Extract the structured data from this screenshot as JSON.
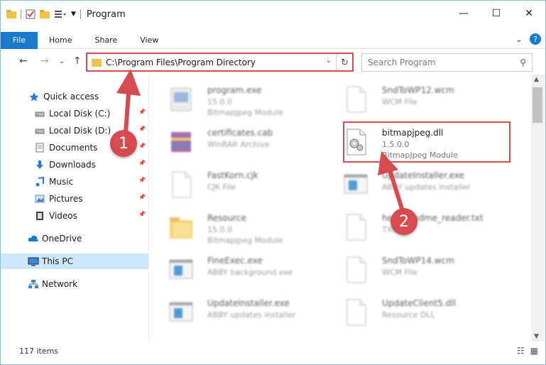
{
  "window": {
    "title": "Program",
    "min": "—",
    "max": "☐",
    "close": "✕"
  },
  "ribbon": {
    "file": "File",
    "tabs": [
      "Home",
      "Share",
      "View"
    ],
    "expand": "⌄",
    "help": "?"
  },
  "nav": {
    "back": "←",
    "forward": "→",
    "recent": "⌄",
    "up": "↑",
    "address": "C:\\Program Files\\Program Directory",
    "dropdown": "⌄",
    "refresh": "↻",
    "search_placeholder": "Search Program",
    "search_icon": "⚲"
  },
  "sidebar": {
    "items": [
      {
        "label": "Quick access",
        "icon": "star-icon",
        "pinned": false
      },
      {
        "label": "Local Disk (C:)",
        "icon": "drive-icon",
        "pinned": true
      },
      {
        "label": "Local Disk (D:)",
        "icon": "drive-icon",
        "pinned": true
      },
      {
        "label": "Documents",
        "icon": "documents-icon",
        "pinned": true
      },
      {
        "label": "Downloads",
        "icon": "download-icon",
        "pinned": true
      },
      {
        "label": "Music",
        "icon": "music-icon",
        "pinned": true
      },
      {
        "label": "Pictures",
        "icon": "pictures-icon",
        "pinned": true
      },
      {
        "label": "Videos",
        "icon": "videos-icon",
        "pinned": true
      },
      {
        "label": "OneDrive",
        "icon": "cloud-icon",
        "pinned": false
      },
      {
        "label": "This PC",
        "icon": "computer-icon",
        "pinned": false
      },
      {
        "label": "Network",
        "icon": "network-icon",
        "pinned": false
      }
    ],
    "pin_glyph": "📌"
  },
  "files": [
    {
      "name": "program.exe",
      "sub1": "15.0.0",
      "sub2": "Bitmapjpeg Module",
      "kind": "exe",
      "blurred": true
    },
    {
      "name": "SndToWP12.wcm",
      "sub1": "WCM File",
      "sub2": "",
      "kind": "doc",
      "blurred": true
    },
    {
      "name": "certificates.cab",
      "sub1": "WinRAR Archive",
      "sub2": "",
      "kind": "rar",
      "blurred": true
    },
    {
      "name": "bitmapjpeg.dll",
      "sub1": "1.5.0.0",
      "sub2": "BitmapJpeg Module",
      "kind": "dll",
      "blurred": false
    },
    {
      "name": "FastKorn.cjk",
      "sub1": "CJK File",
      "sub2": "",
      "kind": "doc",
      "blurred": true
    },
    {
      "name": "UpdateInstaller.exe",
      "sub1": "ABBY updates installer",
      "sub2": "",
      "kind": "app",
      "blurred": true
    },
    {
      "name": "Resource",
      "sub1": "15.0.0",
      "sub2": "Bitmapjpeg Module",
      "kind": "folder",
      "blurred": true
    },
    {
      "name": "help_readme_reader.txt",
      "sub1": "TXT File",
      "sub2": "",
      "kind": "doc",
      "blurred": true
    },
    {
      "name": "FineExec.exe",
      "sub1": "ABBY background exe",
      "sub2": "",
      "kind": "app",
      "blurred": true
    },
    {
      "name": "SndToWP14.wcm",
      "sub1": "WCM File",
      "sub2": "",
      "kind": "doc",
      "blurred": true
    },
    {
      "name": "UpdateInstaller.exe",
      "sub1": "ABBY updates installer",
      "sub2": "",
      "kind": "app",
      "blurred": true
    },
    {
      "name": "UpdateClient5.dll",
      "sub1": "Resource DLL",
      "sub2": "",
      "kind": "doc",
      "blurred": true
    }
  ],
  "status": {
    "count": "117 items",
    "details_view": "☷",
    "tiles_view": "▦"
  },
  "callouts": [
    "1",
    "2"
  ],
  "colors": {
    "accent": "#1979ca",
    "highlight_red": "#d74a4f",
    "selected_bg": "#cce8ff",
    "folder": "#f0c24a"
  }
}
